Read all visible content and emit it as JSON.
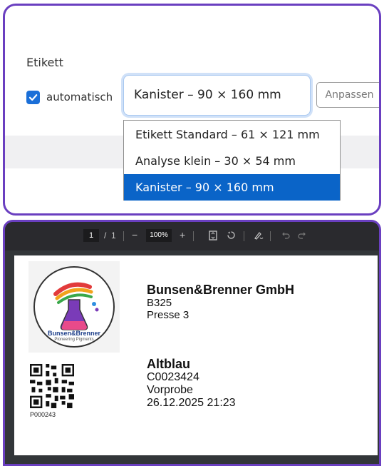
{
  "label_section": {
    "title": "Etikett",
    "auto_checkbox": {
      "label": "automatisch",
      "checked": true
    },
    "select": {
      "value": "Kanister – 90 × 160 mm"
    },
    "customize_button": "Anpassen",
    "dropdown_options": [
      {
        "label": "Etikett Standard – 61 × 121 mm",
        "selected": false
      },
      {
        "label": "Analyse klein – 30 × 54 mm",
        "selected": false
      },
      {
        "label": "Kanister – 90 × 160 mm",
        "selected": true
      }
    ]
  },
  "pdf_viewer": {
    "toolbar": {
      "current_page": "1",
      "page_separator": "/",
      "total_pages": "1",
      "zoom_out": "−",
      "zoom": "100%",
      "zoom_in": "+",
      "icons": [
        "fit-page-icon",
        "rotate-icon",
        "annotate-icon",
        "undo-icon",
        "redo-icon"
      ]
    },
    "label": {
      "logo_text": "Bunsen&Brenner",
      "logo_subtext": "Pioneering Pigments",
      "company": "Bunsen&Brenner GmbH",
      "location_lines": [
        "B325",
        "Presse 3"
      ],
      "product": "Altblau",
      "product_lines": [
        "C0023424",
        "Vorprobe",
        "26.12.2025 21:23"
      ],
      "qr_code_id": "P000243"
    }
  },
  "colors": {
    "panel_border": "#6a3fc0",
    "accent_blue": "#0a64c8",
    "checkbox_blue": "#1a6fd8",
    "viewer_background": "#323639"
  }
}
